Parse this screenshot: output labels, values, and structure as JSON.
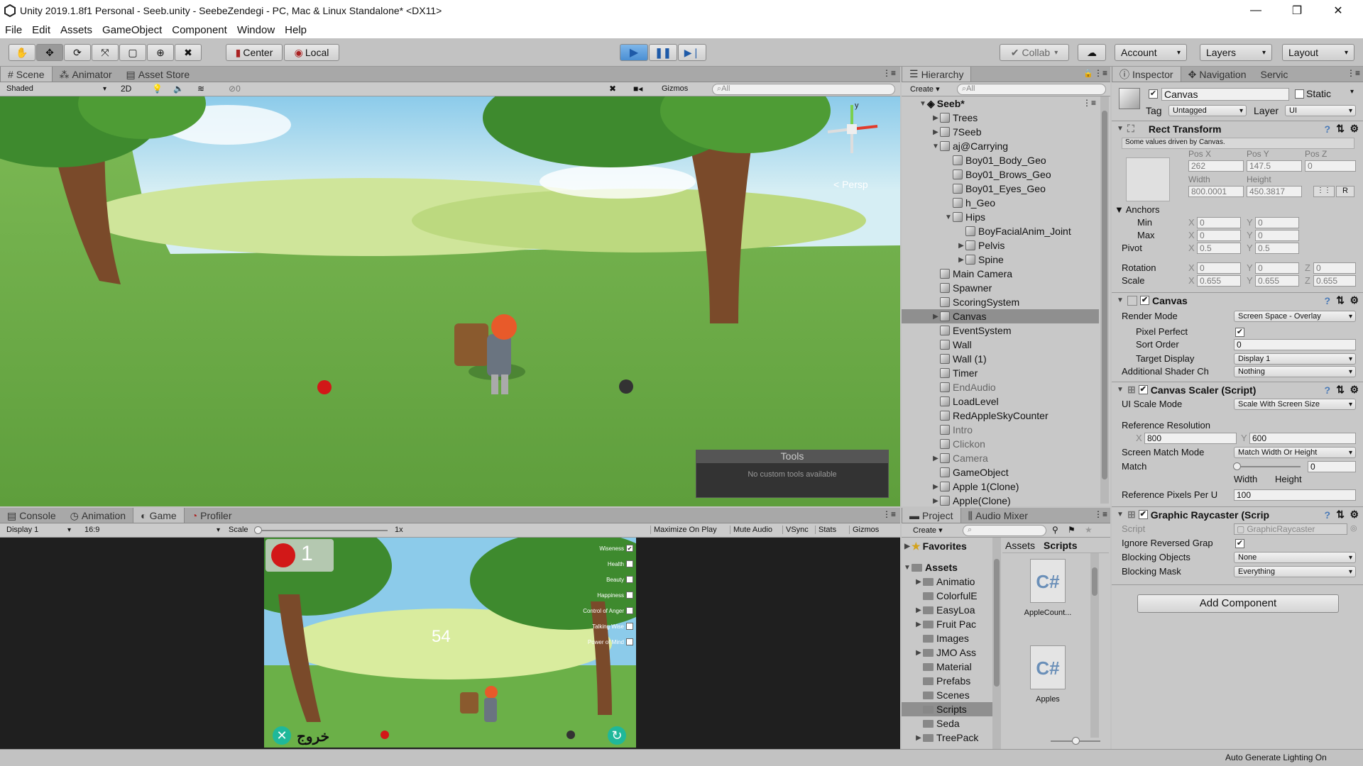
{
  "window": {
    "title": "Unity 2019.1.8f1 Personal - Seeb.unity - SeebeZendegi - PC, Mac & Linux Standalone* <DX11>"
  },
  "menu": [
    "File",
    "Edit",
    "Assets",
    "GameObject",
    "Component",
    "Window",
    "Help"
  ],
  "toolbar": {
    "center_label": "Center",
    "local_label": "Local",
    "collab_label": "Collab",
    "account_label": "Account",
    "layers_label": "Layers",
    "layout_label": "Layout"
  },
  "scene": {
    "tabs": [
      "Scene",
      "Animator",
      "Asset Store"
    ],
    "shading": "Shaded",
    "mode_2d": "2D",
    "fx_count": "0",
    "gizmos": "Gizmos",
    "search_placeholder": "All",
    "persp": "< Persp",
    "gizmo_y": "y",
    "tools_title": "Tools",
    "tools_msg": "No custom tools available"
  },
  "game": {
    "tabs": [
      "Console",
      "Animation",
      "Game",
      "Profiler"
    ],
    "display": "Display 1",
    "aspect": "16:9",
    "scale_label": "Scale",
    "scale_value": "1x",
    "buttons": [
      "Maximize On Play",
      "Mute Audio",
      "VSync",
      "Stats",
      "Gizmos"
    ],
    "apple_count": "1",
    "timer": "54",
    "exit_text": "خروج",
    "checklist": [
      "Wiseness",
      "Health",
      "Beauty",
      "Happiness",
      "Control of Anger",
      "Talking Wise",
      "Power of Mind"
    ]
  },
  "hierarchy": {
    "title": "Hierarchy",
    "create": "Create",
    "search_placeholder": "All",
    "scene_name": "Seeb*",
    "items": [
      {
        "label": "Trees",
        "depth": 1,
        "arrow": "right",
        "dim": false
      },
      {
        "label": "7Seeb",
        "depth": 1,
        "arrow": "right",
        "dim": false
      },
      {
        "label": "aj@Carrying",
        "depth": 1,
        "arrow": "down",
        "dim": false
      },
      {
        "label": "Boy01_Body_Geo",
        "depth": 2,
        "arrow": "",
        "dim": false
      },
      {
        "label": "Boy01_Brows_Geo",
        "depth": 2,
        "arrow": "",
        "dim": false
      },
      {
        "label": "Boy01_Eyes_Geo",
        "depth": 2,
        "arrow": "",
        "dim": false
      },
      {
        "label": "h_Geo",
        "depth": 2,
        "arrow": "",
        "dim": false
      },
      {
        "label": "Hips",
        "depth": 2,
        "arrow": "down",
        "dim": false
      },
      {
        "label": "BoyFacialAnim_Joint",
        "depth": 3,
        "arrow": "",
        "dim": false
      },
      {
        "label": "Pelvis",
        "depth": 3,
        "arrow": "right",
        "dim": false
      },
      {
        "label": "Spine",
        "depth": 3,
        "arrow": "right",
        "dim": false
      },
      {
        "label": "Main Camera",
        "depth": 1,
        "arrow": "",
        "dim": false
      },
      {
        "label": "Spawner",
        "depth": 1,
        "arrow": "",
        "dim": false
      },
      {
        "label": "ScoringSystem",
        "depth": 1,
        "arrow": "",
        "dim": false
      },
      {
        "label": "Canvas",
        "depth": 1,
        "arrow": "right",
        "dim": false,
        "selected": true
      },
      {
        "label": "EventSystem",
        "depth": 1,
        "arrow": "",
        "dim": false
      },
      {
        "label": "Wall",
        "depth": 1,
        "arrow": "",
        "dim": false
      },
      {
        "label": "Wall (1)",
        "depth": 1,
        "arrow": "",
        "dim": false
      },
      {
        "label": "Timer",
        "depth": 1,
        "arrow": "",
        "dim": false
      },
      {
        "label": "EndAudio",
        "depth": 1,
        "arrow": "",
        "dim": true
      },
      {
        "label": "LoadLevel",
        "depth": 1,
        "arrow": "",
        "dim": false
      },
      {
        "label": "RedAppleSkyCounter",
        "depth": 1,
        "arrow": "",
        "dim": false
      },
      {
        "label": "Intro",
        "depth": 1,
        "arrow": "",
        "dim": true
      },
      {
        "label": "Clickon",
        "depth": 1,
        "arrow": "",
        "dim": true
      },
      {
        "label": "Camera",
        "depth": 1,
        "arrow": "right",
        "dim": true
      },
      {
        "label": "GameObject",
        "depth": 1,
        "arrow": "",
        "dim": false
      },
      {
        "label": "Apple 1(Clone)",
        "depth": 1,
        "arrow": "right",
        "dim": false
      },
      {
        "label": "Apple(Clone)",
        "depth": 1,
        "arrow": "right",
        "dim": false
      }
    ]
  },
  "project": {
    "tabs": [
      "Project",
      "Audio Mixer"
    ],
    "create": "Create",
    "favorites": "Favorites",
    "assets": "Assets",
    "breadcrumb": [
      "Assets",
      "Scripts"
    ],
    "folders": [
      "Animatio",
      "ColorfulE",
      "EasyLoa",
      "Fruit Pac",
      "Images",
      "JMO Ass",
      "Material",
      "Prefabs",
      "Scenes",
      "Scripts",
      "Seda",
      "TreePack"
    ],
    "files": [
      {
        "name": "AppleCount...",
        "type": "C#"
      },
      {
        "name": "Apples",
        "type": "C#"
      }
    ]
  },
  "inspector": {
    "tabs": [
      "Inspector",
      "Navigation",
      "Servic"
    ],
    "object_name": "Canvas",
    "static_label": "Static",
    "tag_label": "Tag",
    "tag_value": "Untagged",
    "layer_label": "Layer",
    "layer_value": "UI",
    "rect": {
      "title": "Rect Transform",
      "note": "Some values driven by Canvas.",
      "posx_label": "Pos X",
      "posy_label": "Pos Y",
      "posz_label": "Pos Z",
      "posx": "262",
      "posy": "147.5",
      "posz": "0",
      "width_label": "Width",
      "height_label": "Height",
      "width": "800.0001",
      "height": "450.3817",
      "r_btn": "R",
      "anchors_label": "Anchors",
      "min_label": "Min",
      "max_label": "Max",
      "min_x": "0",
      "min_y": "0",
      "max_x": "0",
      "max_y": "0",
      "pivot_label": "Pivot",
      "pivot_x": "0.5",
      "pivot_y": "0.5",
      "rotation_label": "Rotation",
      "rot_x": "0",
      "rot_y": "0",
      "rot_z": "0",
      "scale_label": "Scale",
      "scale_x": "0.655",
      "scale_y": "0.655",
      "scale_z": "0.655"
    },
    "canvas": {
      "title": "Canvas",
      "render_mode_label": "Render Mode",
      "render_mode": "Screen Space - Overlay",
      "pixel_perfect_label": "Pixel Perfect",
      "sort_order_label": "Sort Order",
      "sort_order": "0",
      "target_display_label": "Target Display",
      "target_display": "Display 1",
      "shader_label": "Additional Shader Ch",
      "shader_value": "Nothing"
    },
    "scaler": {
      "title": "Canvas Scaler (Script)",
      "ui_scale_label": "UI Scale Mode",
      "ui_scale": "Scale With Screen Size",
      "ref_res_label": "Reference Resolution",
      "ref_x": "800",
      "ref_y": "600",
      "match_mode_label": "Screen Match Mode",
      "match_mode": "Match Width Or Height",
      "match_label": "Match",
      "match_value": "0",
      "width_label": "Width",
      "height_label": "Height",
      "ref_pixels_label": "Reference Pixels Per U",
      "ref_pixels": "100"
    },
    "raycaster": {
      "title": "Graphic Raycaster (Scrip",
      "script_label": "Script",
      "script_value": "GraphicRaycaster",
      "ignore_label": "Ignore Reversed Grap",
      "blocking_label": "Blocking Objects",
      "blocking_value": "None",
      "mask_label": "Blocking Mask",
      "mask_value": "Everything"
    },
    "add_component": "Add Component"
  },
  "status": {
    "text": "Auto Generate Lighting On"
  }
}
